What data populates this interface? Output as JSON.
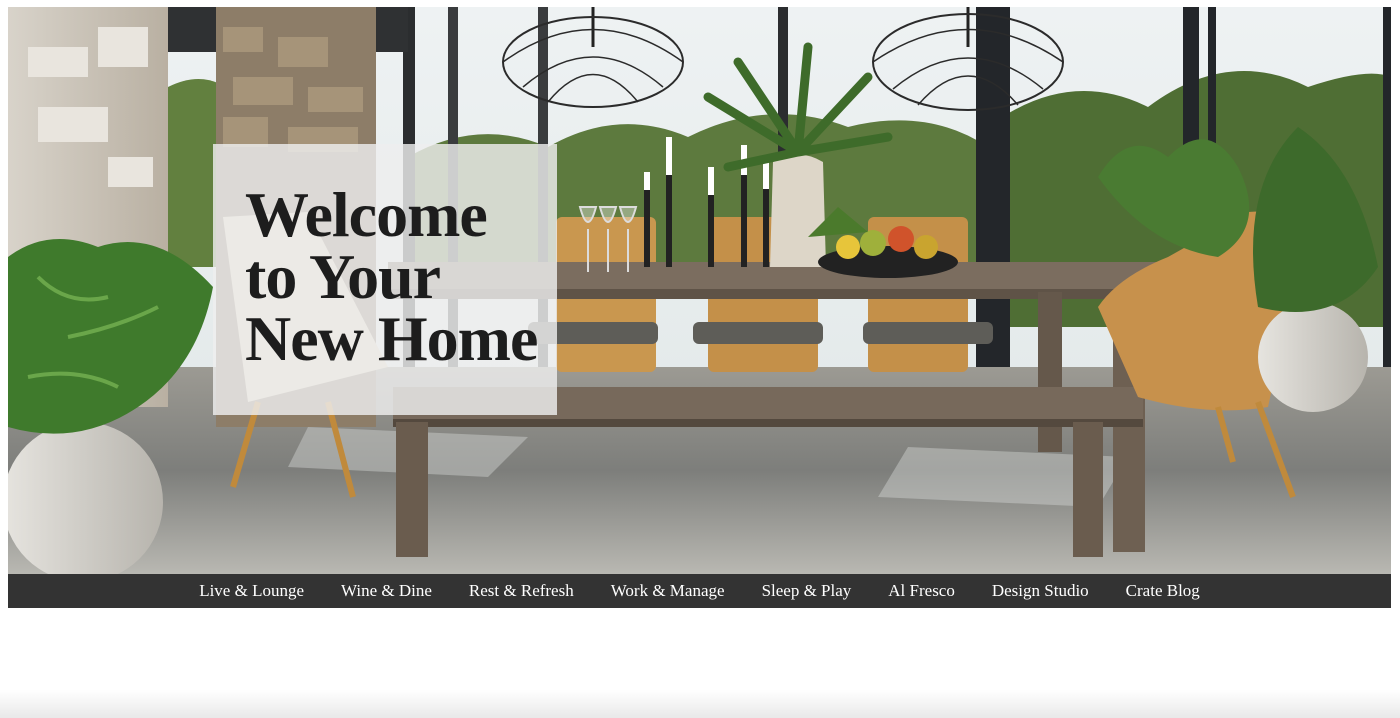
{
  "hero": {
    "title_lines": [
      "Welcome",
      "to Your",
      "New Home"
    ]
  },
  "nav": {
    "items": [
      {
        "label": "Live & Lounge"
      },
      {
        "label": "Wine & Dine"
      },
      {
        "label": "Rest & Refresh"
      },
      {
        "label": "Work & Manage"
      },
      {
        "label": "Sleep & Play"
      },
      {
        "label": "Al Fresco"
      },
      {
        "label": "Design Studio"
      },
      {
        "label": "Crate Blog"
      }
    ]
  },
  "colors": {
    "nav_background": "#333333",
    "nav_text": "#ffffff",
    "panel_background": "#eeeeee",
    "title_text": "#1d1d1d"
  }
}
